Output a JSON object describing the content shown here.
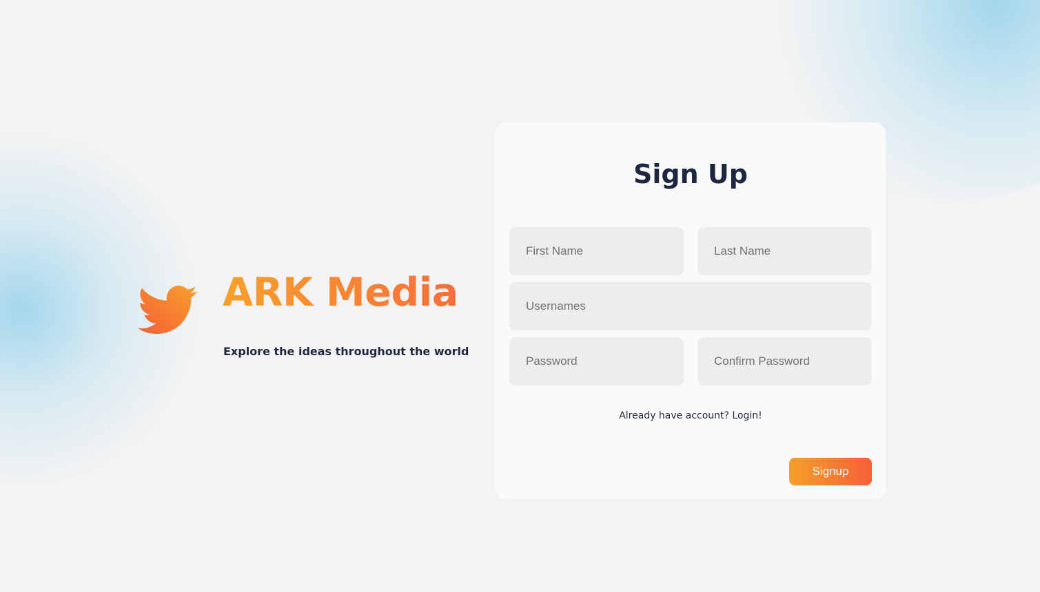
{
  "brand": {
    "logo_icon": "bird-icon",
    "name": "ARK Media",
    "tagline": "Explore the ideas throughout the world"
  },
  "signup_form": {
    "title": "Sign Up",
    "first_name": {
      "placeholder": "First Name",
      "value": ""
    },
    "last_name": {
      "placeholder": "Last Name",
      "value": ""
    },
    "username": {
      "placeholder": "Usernames",
      "value": ""
    },
    "password": {
      "placeholder": "Password",
      "value": ""
    },
    "confirm_password": {
      "placeholder": "Confirm Password",
      "value": ""
    },
    "login_link": "Already have account? Login!",
    "submit_label": "Signup"
  },
  "colors": {
    "background": "#f3f3f3",
    "card": "#fafafa",
    "field": "#ecedec",
    "text_dark": "#1e2740",
    "accent_start": "#f7a02a",
    "accent_end": "#f55f37",
    "blob": "#b4dcef"
  }
}
